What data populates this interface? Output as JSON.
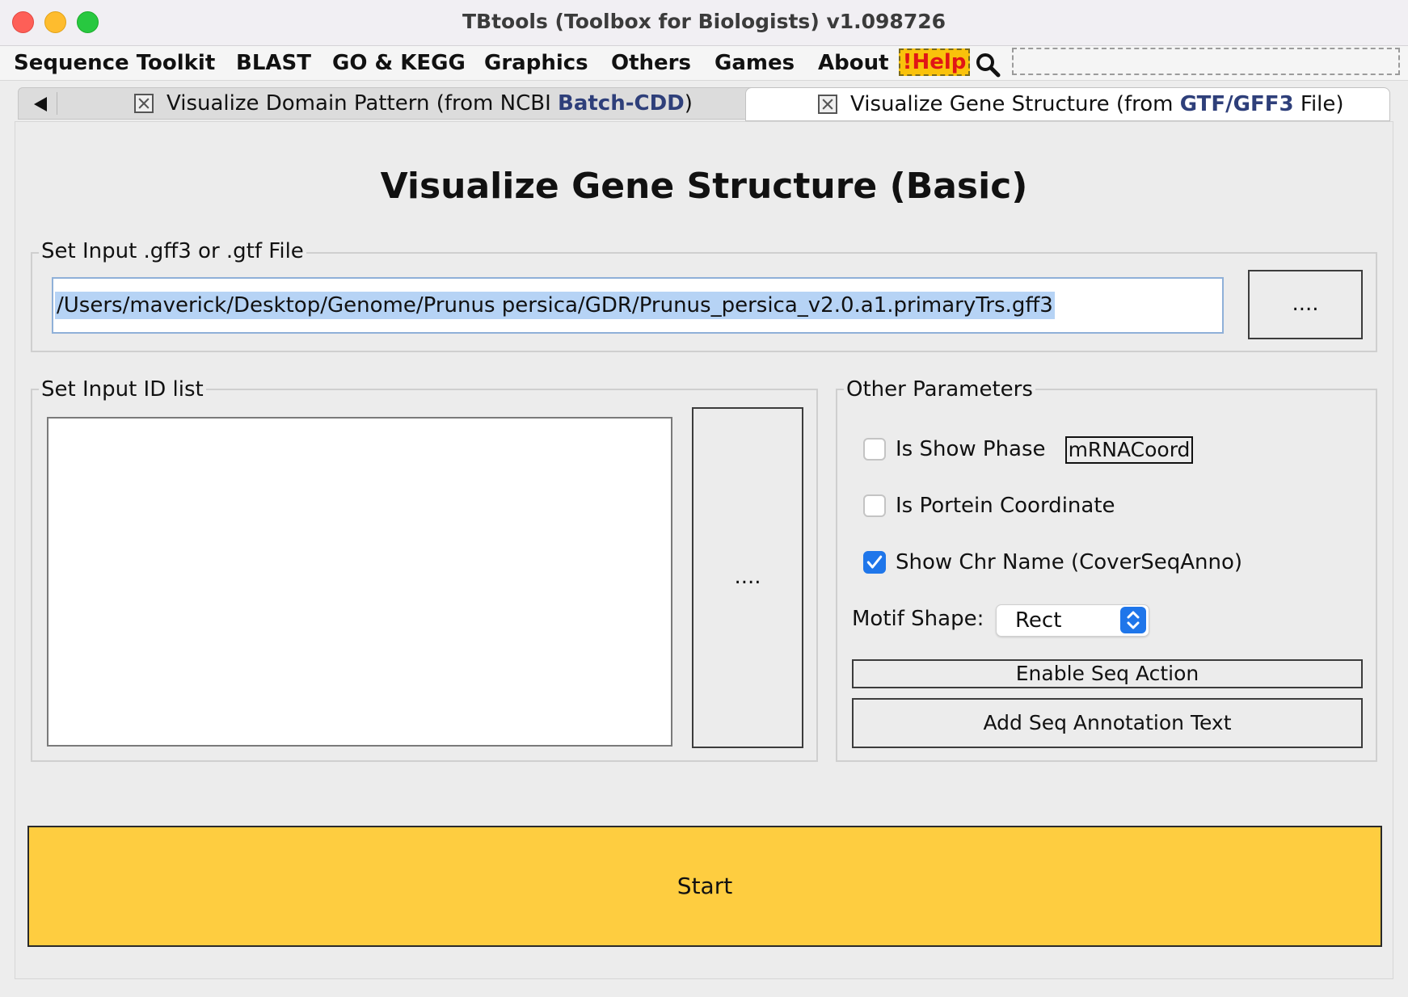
{
  "window": {
    "title": "TBtools (Toolbox for Biologists) v1.098726"
  },
  "menu": {
    "items": [
      "Sequence Toolkit",
      "BLAST",
      "GO & KEGG",
      "Graphics",
      "Others",
      "Games",
      "About"
    ],
    "help_label": "!Help"
  },
  "tabs": [
    {
      "label_prefix": "Visualize Domain Pattern (from NCBI ",
      "label_highlight": "Batch-CDD",
      "label_suffix": ")",
      "active": false
    },
    {
      "label_prefix": "Visualize Gene Structure (from ",
      "label_highlight": "GTF/GFF3",
      "label_suffix": " File)",
      "active": true
    }
  ],
  "main": {
    "heading": "Visualize Gene Structure (Basic)",
    "input_file": {
      "legend": "Set Input .gff3 or .gtf File",
      "value": "/Users/maverick/Desktop/Genome/Prunus persica/GDR/Prunus_persica_v2.0.a1.primaryTrs.gff3",
      "browse_label": "...."
    },
    "id_list": {
      "legend": "Set Input ID list",
      "browse_label": "...."
    },
    "params": {
      "legend": "Other Parameters",
      "show_phase": {
        "label": "Is Show Phase",
        "checked": false
      },
      "mrna_coord": "mRNACoord",
      "protein_coord": {
        "label": "Is Portein Coordinate",
        "checked": false
      },
      "show_chr_name": {
        "label": "Show Chr Name (CoverSeqAnno)",
        "checked": true
      },
      "motif_shape": {
        "label": "Motif Shape:",
        "value": "Rect"
      },
      "enable_seq_action": "Enable Seq Action",
      "add_seq_annotation": "Add Seq Annotation Text"
    },
    "start_label": "Start"
  },
  "colors": {
    "start_button": "#fecd40",
    "help_bg": "#f9c20b",
    "help_text": "#e01616",
    "accent": "#1f76ea",
    "tab_highlight": "#2e3f7a"
  }
}
